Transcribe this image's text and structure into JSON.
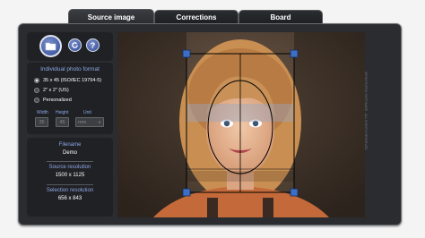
{
  "tabs": [
    {
      "label": "Source image",
      "active": true
    },
    {
      "label": "Corrections",
      "active": false
    },
    {
      "label": "Board",
      "active": false
    }
  ],
  "toolbar": {
    "help_label": "?"
  },
  "format": {
    "title": "Individual photo format",
    "options": [
      {
        "label": "35 x 45 (ISO/IEC 19794-5)",
        "selected": true
      },
      {
        "label": "2\" x 2\" (US)",
        "selected": false
      },
      {
        "label": "Personalized",
        "selected": false
      }
    ],
    "width_label": "Width",
    "height_label": "Height",
    "unit_label": "Unit",
    "width_value": "35",
    "height_value": "45",
    "unit_value": "mm"
  },
  "info": {
    "filename_label": "Filename",
    "filename_value": "Demo",
    "source_res_label": "Source resolution",
    "source_res_value": "1500 x 1125",
    "selection_res_label": "Selection resolution",
    "selection_res_value": "656 x 843"
  },
  "side_text": "IDPHOTOPRO SOFTWARE - ALL RIGHTS RESERVED",
  "colors": {
    "accent": "#8fa7e6",
    "panel": "#2a2c2f",
    "handle": "#3d6fc7"
  }
}
